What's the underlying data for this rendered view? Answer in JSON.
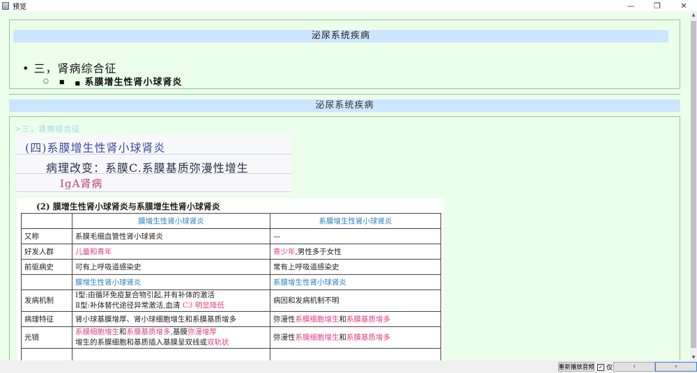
{
  "window": {
    "title": "预览",
    "minimize": "—",
    "restore": "❐",
    "close": "✕"
  },
  "front": {
    "deck": "泌尿系统疾病",
    "item1": "三，肾病综合征",
    "item2_bullets": [
      "○",
      "■",
      "■"
    ],
    "item2": "系膜增生性肾小球肾炎"
  },
  "back": {
    "deck": "泌尿系统疾病",
    "crumb": ">三，肾病综合征",
    "note": {
      "line1": "(四)系膜增生性肾小球肾炎",
      "line2": "病理改变：系膜C.系膜基质弥漫性增生",
      "line3": "IgA肾病"
    },
    "table": {
      "title": "(2) 膜增生性肾小球肾炎与系膜增生性肾小球肾炎",
      "header": [
        "",
        "膜增生性肾小球肾炎",
        "系膜增生性肾小球肾炎"
      ],
      "r_aka": {
        "label": "又称",
        "a": "系膜毛细血管性肾小球肾炎",
        "b": "—"
      },
      "r_pop": {
        "label": "好发人群",
        "a": "儿童和青年",
        "b1": "青少年",
        "b2": ",男性多于女性"
      },
      "r_pre": {
        "label": "前驱病史",
        "a": "可有上呼吸道感染史",
        "b": "常有上呼吸道感染史"
      },
      "r_sub": {
        "a": "膜增生性肾小球肾炎",
        "b": "系膜增生性肾小球肾炎"
      },
      "r_mech": {
        "label": "发病机制",
        "a1": "Ⅰ型:由循环免疫复合物引起,并有补体的激活",
        "a2": "Ⅱ型:补体替代途径异常激活,血清 ",
        "a3": "C3 明显降低",
        "b": "病因和发病机制不明"
      },
      "r_path": {
        "label": "病理特征",
        "a": "肾小球基膜增厚、肾小球细胞增生和系膜基质增多",
        "b1": "弥漫性",
        "b2": "系膜细胞增生",
        "b3": "和",
        "b4": "系膜基质增多"
      },
      "r_lm": {
        "label": "光镜",
        "a1": "系膜细胞增生",
        "a2": "和",
        "a3": "系膜基质增多",
        "a4": ",基膜",
        "a5": "弥漫增厚",
        "a6": "增生的系膜细胞和基质插入基膜呈双线或",
        "a7": "双轨状",
        "b1": "弥漫性",
        "b2": "系膜细胞增生",
        "b3": "和",
        "b4": "系膜基质增多"
      }
    }
  },
  "bottombar": {
    "replay": "重新播放音频",
    "back_only": "仅背面",
    "back_only_checked": "✓",
    "prev": "‹",
    "next": "›"
  },
  "colors": {
    "background": "#ebffeb",
    "header": "#cce6ff",
    "border": "#8fc98f",
    "pink": "#e0417e",
    "blue": "#2a7fc0"
  }
}
